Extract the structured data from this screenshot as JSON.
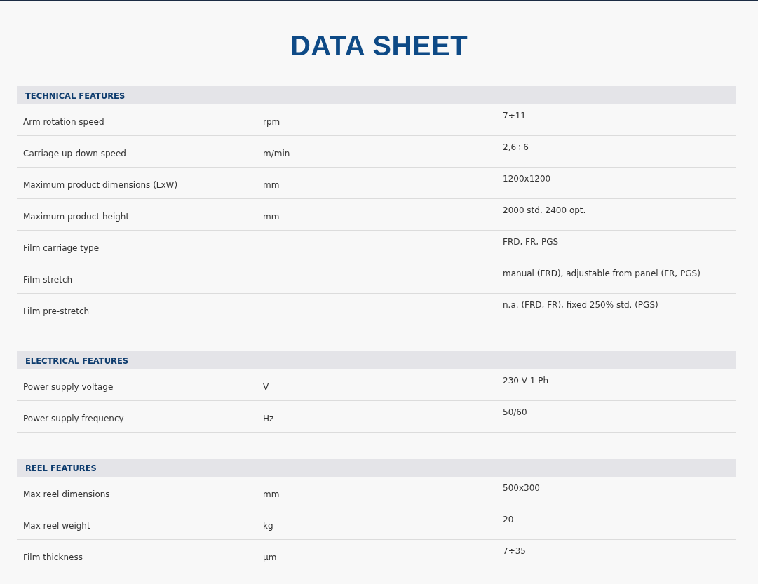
{
  "title": "DATA SHEET",
  "sections": [
    {
      "heading": "TECHNICAL FEATURES",
      "rows": [
        {
          "label": "Arm rotation speed",
          "unit": "rpm",
          "value": "7÷11"
        },
        {
          "label": "Carriage up-down speed",
          "unit": "m/min",
          "value": "2,6÷6"
        },
        {
          "label": "Maximum product dimensions (LxW)",
          "unit": "mm",
          "value": "1200x1200"
        },
        {
          "label": "Maximum product height",
          "unit": "mm",
          "value": "2000 std. 2400 opt."
        },
        {
          "label": "Film carriage type",
          "value": "FRD, FR, PGS"
        },
        {
          "label": "Film stretch",
          "value": "manual (FRD), adjustable from panel (FR, PGS)"
        },
        {
          "label": "Film pre-stretch",
          "value": "n.a. (FRD, FR), fixed 250% std. (PGS)"
        }
      ]
    },
    {
      "heading": "ELECTRICAL FEATURES",
      "rows": [
        {
          "label": "Power supply voltage",
          "unit": "V",
          "value": "230 V 1 Ph"
        },
        {
          "label": "Power supply frequency",
          "unit": "Hz",
          "value": "50/60"
        }
      ]
    },
    {
      "heading": "REEL FEATURES",
      "rows": [
        {
          "label": "Max reel dimensions",
          "unit": "mm",
          "value": "500x300"
        },
        {
          "label": "Max reel weight",
          "unit": "kg",
          "value": "20"
        },
        {
          "label": "Film thickness",
          "unit": "µm",
          "value": "7÷35"
        }
      ]
    }
  ]
}
